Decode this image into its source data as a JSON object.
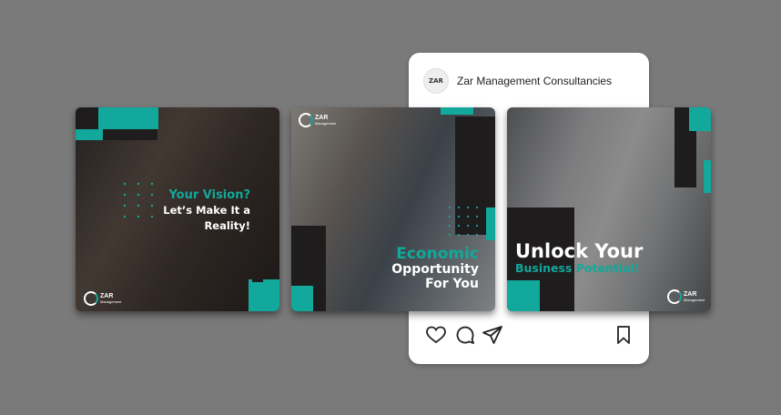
{
  "post": {
    "account_name": "Zar Management Consultancies",
    "avatar_text": "ZAR"
  },
  "tiles": [
    {
      "headline_accent": "Your Vision?",
      "headline_lines": [
        "Let’s Make It a",
        "Reality!"
      ],
      "logo": {
        "main": "ZAR",
        "sub": "Management"
      }
    },
    {
      "headline_accent": "Economic",
      "headline_lines": [
        "Opportunity",
        "For You"
      ],
      "logo": {
        "main": "ZAR",
        "sub": "Management"
      }
    },
    {
      "headline_main": "Unlock Your",
      "headline_accent": "Business Potential!",
      "logo": {
        "main": "ZAR",
        "sub": "Management"
      }
    }
  ],
  "icons": [
    "heart-icon",
    "comment-icon",
    "send-icon",
    "bookmark-icon"
  ],
  "colors": {
    "accent": "#12a89b",
    "dark": "#1f1c1e",
    "background": "#7a7a7a",
    "card": "#ffffff"
  }
}
